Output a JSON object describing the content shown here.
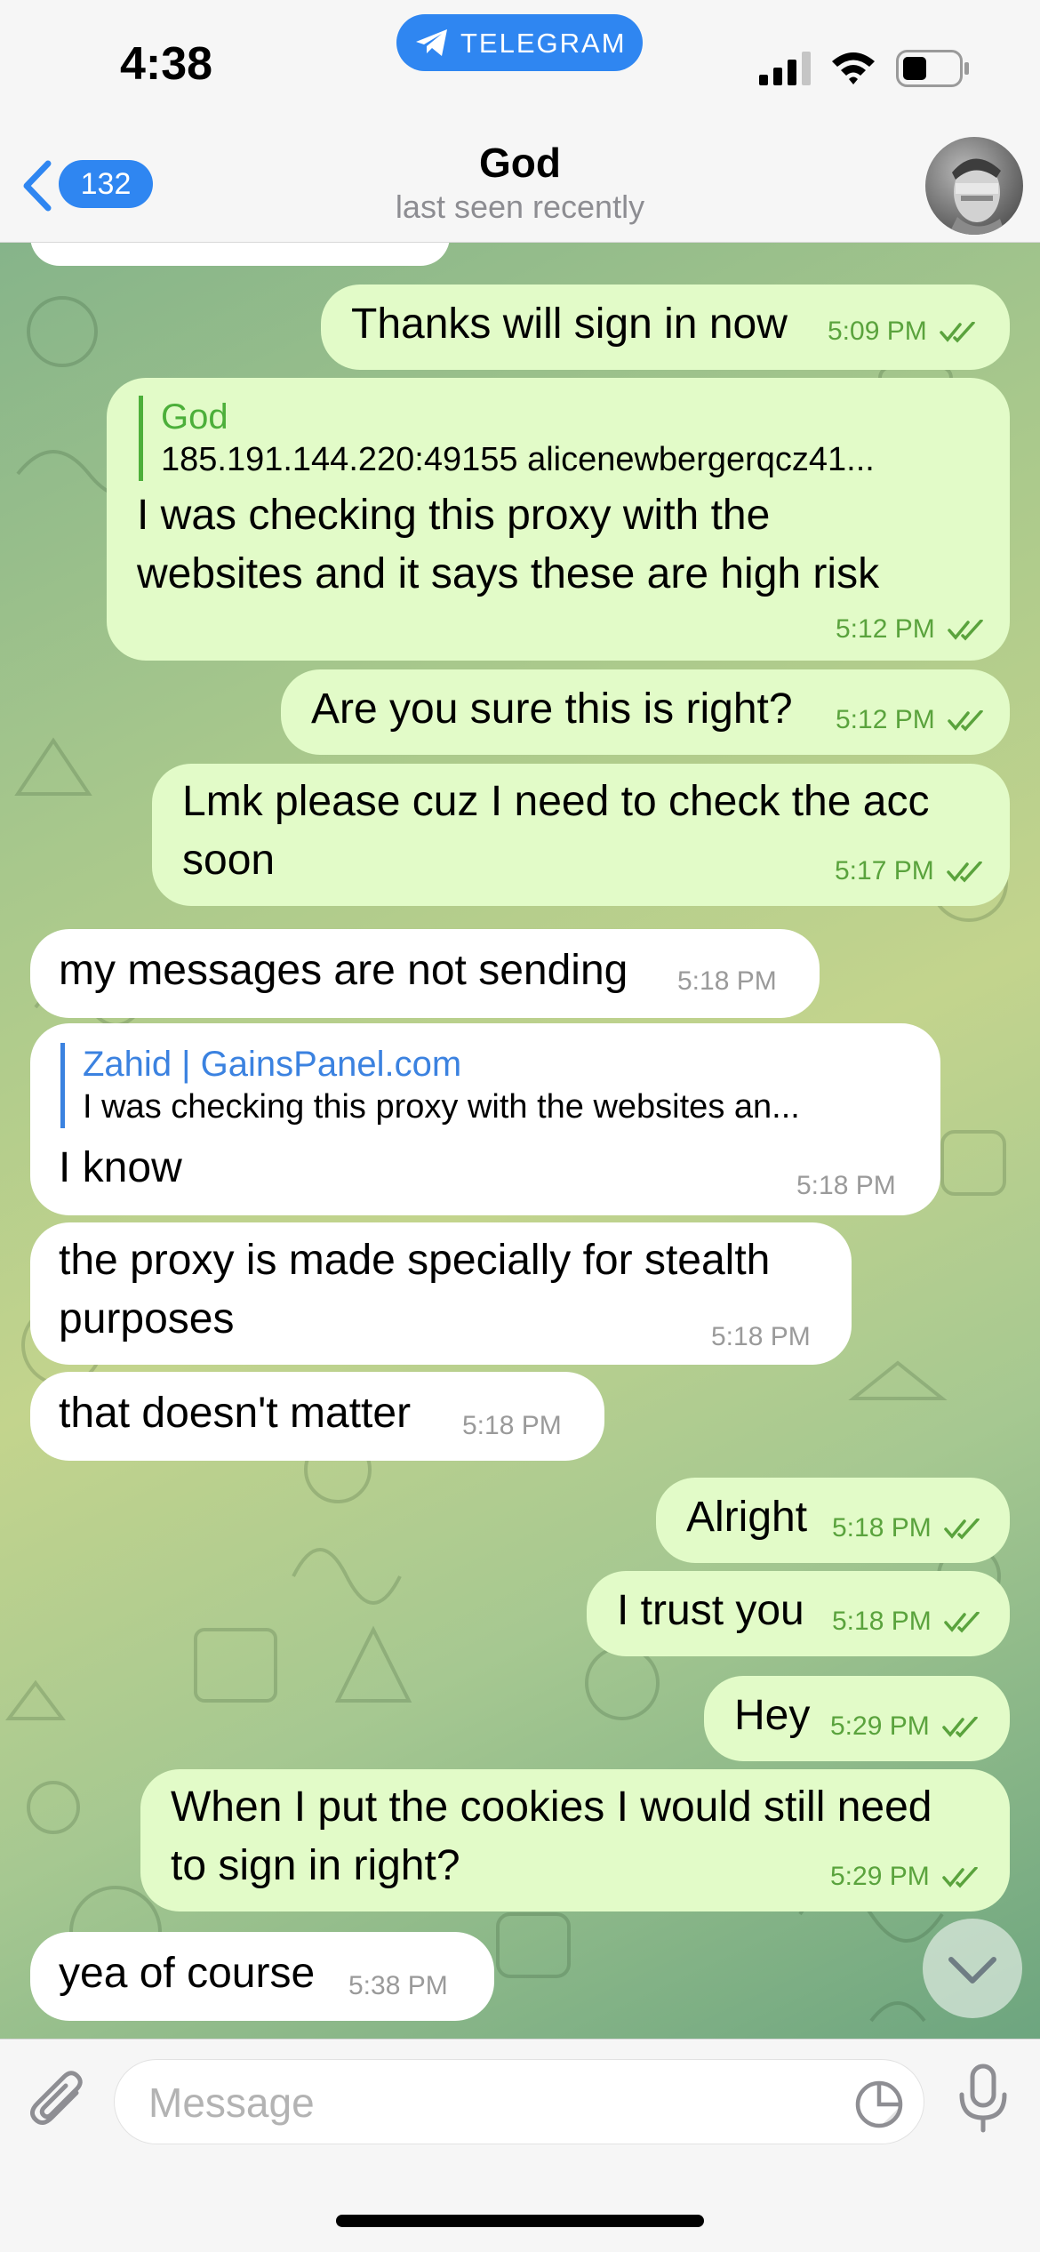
{
  "status_bar": {
    "time": "4:38",
    "app_pill": "TELEGRAM"
  },
  "header": {
    "back_count": "132",
    "contact_name": "God",
    "status": "last seen recently"
  },
  "messages": [
    {
      "dir": "out",
      "text": "Thanks will sign in now",
      "time": "5:09 PM"
    },
    {
      "dir": "out",
      "reply_name": "God",
      "reply_text": "185.191.144.220:49155  alicenewbergerqcz41...",
      "text": [
        "I was checking this proxy with the",
        "websites and it says these are high risk"
      ],
      "time": "5:12 PM"
    },
    {
      "dir": "out",
      "text": "Are you sure this is right?",
      "time": "5:12 PM"
    },
    {
      "dir": "out",
      "text": [
        "Lmk please cuz I need to check the acc",
        "soon"
      ],
      "time": "5:17 PM"
    },
    {
      "dir": "in",
      "text": "my messages are not sending",
      "time": "5:18 PM"
    },
    {
      "dir": "in",
      "reply_name": "Zahid | GainsPanel.com",
      "reply_text": "I was checking this proxy with the websites an...",
      "text": "I know",
      "time": "5:18 PM"
    },
    {
      "dir": "in",
      "text": [
        "the proxy is made specially for stealth",
        "purposes"
      ],
      "time": "5:18 PM"
    },
    {
      "dir": "in",
      "text": "that doesn't matter",
      "time": "5:18 PM"
    },
    {
      "dir": "out",
      "text": "Alright",
      "time": "5:18 PM"
    },
    {
      "dir": "out",
      "text": "I trust you",
      "time": "5:18 PM"
    },
    {
      "dir": "out",
      "text": "Hey",
      "time": "5:29 PM"
    },
    {
      "dir": "out",
      "text": [
        "When I put the cookies I would still need",
        "to sign in right?"
      ],
      "time": "5:29 PM"
    },
    {
      "dir": "in",
      "text": "yea of course",
      "time": "5:38 PM"
    }
  ],
  "composer": {
    "placeholder": "Message",
    "value": ""
  },
  "colors": {
    "accent": "#2f86f1",
    "outgoing_bubble": "#e2fbc8",
    "outgoing_meta": "#5aa33d",
    "incoming_bubble": "#ffffff",
    "incoming_meta": "#9a9a9a",
    "reply_in": "#3b82e0",
    "reply_out": "#4caf3a"
  },
  "icons": [
    "telegram-plane-icon",
    "signal-icon",
    "wifi-icon",
    "battery-icon",
    "back-chevron-icon",
    "read-checks-icon",
    "scroll-down-icon",
    "attach-icon",
    "sticker-icon",
    "microphone-icon"
  ]
}
